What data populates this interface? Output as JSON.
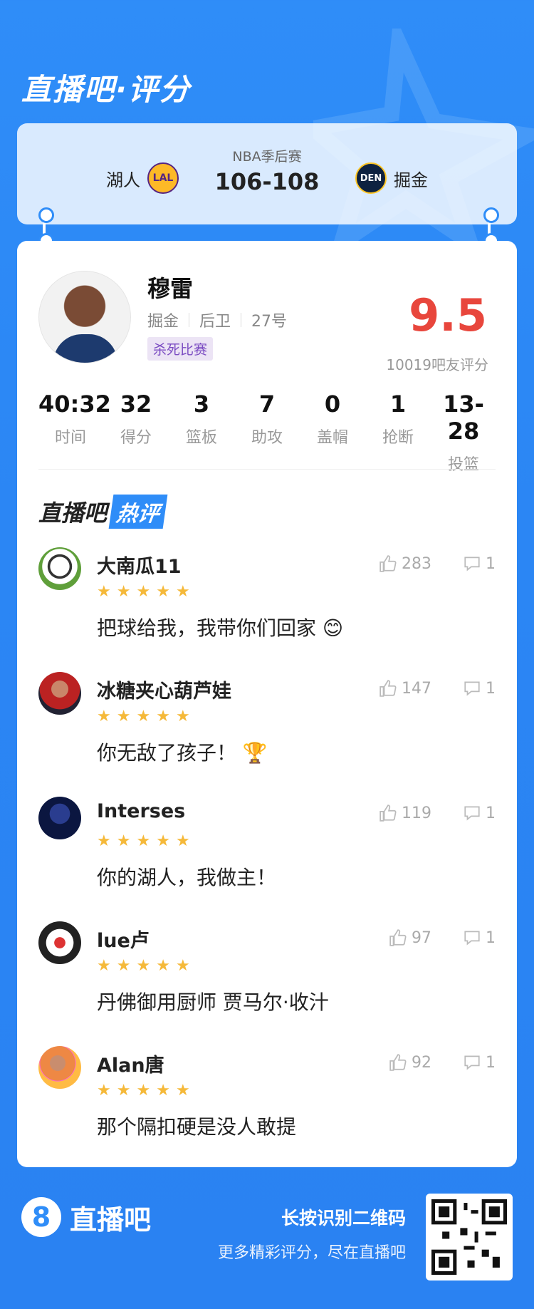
{
  "header": {
    "brand_title": "直播吧·评分"
  },
  "match": {
    "label": "NBA季后赛",
    "score": "106-108",
    "home_team": "湖人",
    "home_logo": "LAL",
    "away_team": "掘金",
    "away_logo": "DEN"
  },
  "player": {
    "name": "穆雷",
    "team": "掘金",
    "position": "后卫",
    "number": "27号",
    "tag": "杀死比赛",
    "rating": "9.5",
    "rating_sub": "10019吧友评分"
  },
  "stats": [
    {
      "value": "40:32",
      "label": "时间"
    },
    {
      "value": "32",
      "label": "得分"
    },
    {
      "value": "3",
      "label": "篮板"
    },
    {
      "value": "7",
      "label": "助攻"
    },
    {
      "value": "0",
      "label": "盖帽"
    },
    {
      "value": "1",
      "label": "抢断"
    },
    {
      "value": "13-28",
      "label": "投篮"
    }
  ],
  "hot": {
    "title_part1": "直播吧",
    "title_part2": "热评"
  },
  "comments": [
    {
      "user": "大南瓜11",
      "stars": 5,
      "text": "把球给我，我带你们回家",
      "likes": "283",
      "replies": "1"
    },
    {
      "user": "冰糖夹心葫芦娃",
      "stars": 5,
      "text": "你无敌了孩子！",
      "likes": "147",
      "replies": "1"
    },
    {
      "user": "Interses",
      "stars": 5,
      "text": "你的湖人，我做主！",
      "likes": "119",
      "replies": "1"
    },
    {
      "user": "lue卢",
      "stars": 5,
      "text": "丹佛御用厨师 贾马尔·收汁",
      "likes": "97",
      "replies": "1"
    },
    {
      "user": "Alan唐",
      "stars": 5,
      "text": "那个隔扣硬是没人敢提",
      "likes": "92",
      "replies": "1"
    }
  ],
  "footer": {
    "logo_digit": "8",
    "logo_name": "直播吧",
    "line1": "长按识别二维码",
    "line2": "更多精彩评分，尽在直播吧"
  },
  "colors": {
    "accent": "#2f8df8",
    "rating": "#e8463c",
    "star": "#f5b93a"
  }
}
